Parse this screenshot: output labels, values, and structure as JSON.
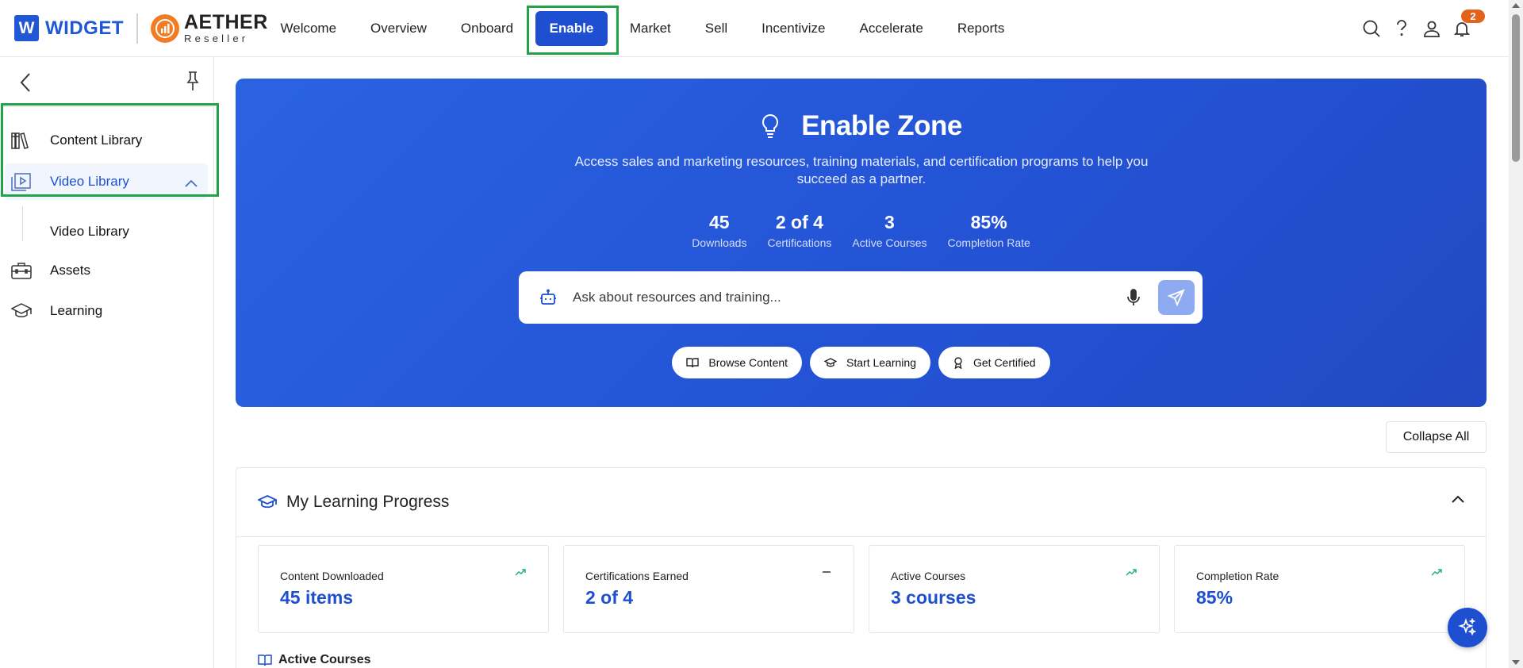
{
  "brand": {
    "widget": "WIDGET",
    "widget_letter": "W",
    "aether": "AETHER",
    "aether_sub": "Reseller"
  },
  "nav": {
    "items": [
      {
        "label": "Welcome"
      },
      {
        "label": "Overview"
      },
      {
        "label": "Onboard"
      },
      {
        "label": "Enable",
        "active": true
      },
      {
        "label": "Market"
      },
      {
        "label": "Sell"
      },
      {
        "label": "Incentivize"
      },
      {
        "label": "Accelerate"
      },
      {
        "label": "Reports"
      }
    ],
    "notification_count": "2"
  },
  "sidebar": {
    "items": [
      {
        "label": "Content Library",
        "icon": "books-icon"
      },
      {
        "label": "Video Library",
        "icon": "video-library-icon",
        "expanded": true
      },
      {
        "label": "Assets",
        "icon": "briefcase-icon"
      },
      {
        "label": "Learning",
        "icon": "graduation-cap-icon"
      }
    ],
    "sub_item": "Video Library"
  },
  "hero": {
    "title": "Enable Zone",
    "description": "Access sales and marketing resources, training materials, and certification programs to help you succeed as a partner.",
    "stats": [
      {
        "value": "45",
        "label": "Downloads"
      },
      {
        "value": "2 of 4",
        "label": "Certifications"
      },
      {
        "value": "3",
        "label": "Active Courses"
      },
      {
        "value": "85%",
        "label": "Completion Rate"
      }
    ],
    "search_placeholder": "Ask about resources and training...",
    "pills": [
      {
        "label": "Browse Content",
        "icon": "book-open-icon"
      },
      {
        "label": "Start Learning",
        "icon": "graduation-cap-icon"
      },
      {
        "label": "Get Certified",
        "icon": "award-icon"
      }
    ]
  },
  "collapse_all": "Collapse All",
  "progress": {
    "title": "My Learning Progress",
    "cards": [
      {
        "label": "Content Downloaded",
        "value": "45 items",
        "trend": "up"
      },
      {
        "label": "Certifications Earned",
        "value": "2 of 4",
        "trend": "flat"
      },
      {
        "label": "Active Courses",
        "value": "3 courses",
        "trend": "up"
      },
      {
        "label": "Completion Rate",
        "value": "85%",
        "trend": "up"
      }
    ],
    "active_courses_heading": "Active Courses"
  },
  "colors": {
    "brand_blue": "#1d4fd0",
    "hero_blue": "#2a63e2",
    "highlight_green": "#22a34a",
    "badge_orange": "#e2631b",
    "trend_green": "#22b573"
  }
}
